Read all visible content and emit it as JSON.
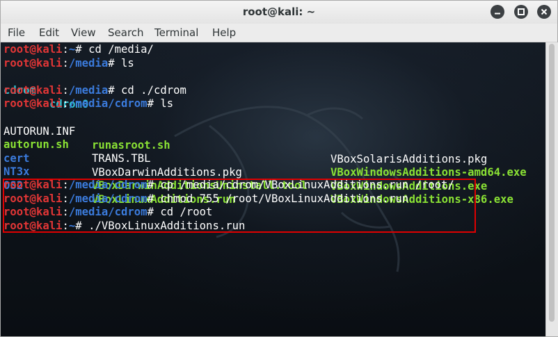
{
  "window": {
    "title": "root@kali: ~"
  },
  "window_buttons": {
    "minimize": "minimize-icon",
    "maximize": "maximize-icon",
    "close": "close-icon"
  },
  "menu": [
    "File",
    "Edit",
    "View",
    "Search",
    "Terminal",
    "Help"
  ],
  "prompt": {
    "user": "root@kali",
    "sep": ":",
    "sym": "# "
  },
  "lines": [
    {
      "path": "~",
      "cmd": "cd /media/"
    },
    {
      "path": "/media",
      "cmd": "ls"
    },
    {
      "path": "/media",
      "cmd": "cd ./cdrom"
    },
    {
      "path": "/media/cdrom",
      "cmd": "ls"
    },
    {
      "path": "/media/cdrom",
      "cmd": "cp /media/cdrom/VBoxLinuxAdditions.run /root/"
    },
    {
      "path": "/media/cdrom",
      "cmd": "chmod 755 /root/VBoxLinuxAdditions.run"
    },
    {
      "path": "/media/cdrom",
      "cmd": "cd /root"
    },
    {
      "path": "~",
      "cmd": "./VBoxLinuxAdditions.run"
    }
  ],
  "media_ls": [
    "cdrom",
    "cdrom0"
  ],
  "cdrom_ls": [
    [
      "AUTORUN.INF",
      "runasroot.sh",
      "VBoxSolarisAdditions.pkg"
    ],
    [
      "autorun.sh",
      "TRANS.TBL",
      "VBoxWindowsAdditions-amd64.exe"
    ],
    [
      "cert",
      "VBoxDarwinAdditions.pkg",
      "VBoxWindowsAdditions.exe"
    ],
    [
      "NT3x",
      "VBoxDarwinAdditionsUninstall.tool",
      "VBoxWindowsAdditions-x86.exe"
    ],
    [
      "OS2",
      "VBoxLinuxAdditions.run",
      ""
    ]
  ],
  "colors": {
    "prompt_user": "#e23636",
    "prompt_path": "#3b7bdc",
    "executable": "#8ae234",
    "directory_cyan": "#2fc4d4",
    "highlight": "#e00000"
  }
}
